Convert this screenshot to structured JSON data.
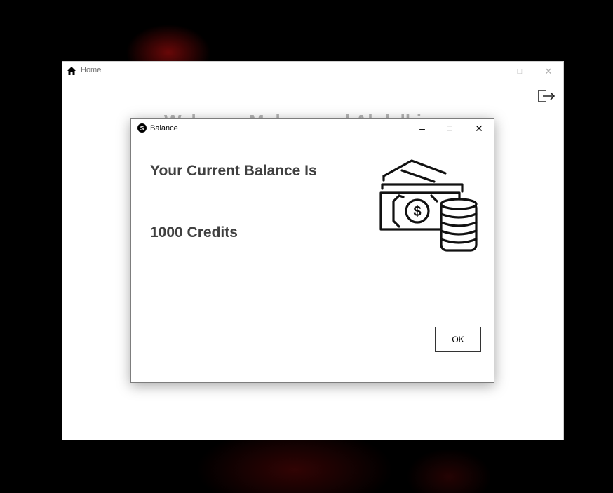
{
  "home_window": {
    "title": "Home",
    "heading": "Welcome Muhammed Abdelhi",
    "controls": {
      "minimize": "–",
      "maximize": "□",
      "close": "✕"
    }
  },
  "balance_dialog": {
    "title": "Balance",
    "controls": {
      "minimize": "–",
      "maximize": "□",
      "close": "✕"
    },
    "heading": "Your Current Balance Is",
    "value": "1000 Credits",
    "ok_label": "OK"
  }
}
